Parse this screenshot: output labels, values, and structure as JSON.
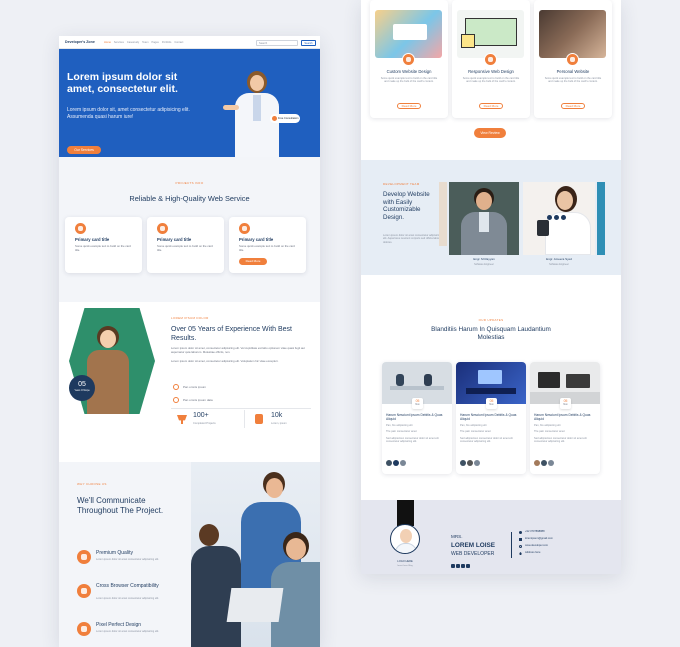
{
  "left_page": {
    "nav": {
      "logo": "Developer's Zone",
      "links": [
        "Home",
        "Services",
        "Casestudy",
        "Team",
        "Pages",
        "Portfolio",
        "Contact"
      ],
      "search_placeholder": "Search",
      "search_button": "Search"
    },
    "hero": {
      "title": "Lorem ipsum dolor sit amet, consectetur elit.",
      "subtitle": "Lorem ipsum dolor sit, amet consectetur adipisicing elit. Assumenda quasi harum iure!",
      "button": "Our Services",
      "badge": "Free Consultation"
    },
    "services": {
      "tag": "PROJECTS INFO",
      "title": "Reliable & High-Quality Web Service",
      "cards": [
        {
          "title": "Primary card title",
          "text": "Some quick example text to build on the card title.",
          "button": ""
        },
        {
          "title": "Primary card title",
          "text": "Some quick example text to build on the card title.",
          "button": ""
        },
        {
          "title": "Primary card title",
          "text": "Some quick example text to build on the card title.",
          "button": "Read More"
        }
      ]
    },
    "experience": {
      "tag": "LOREM IPSUM DOLOR",
      "title": "Over 05 Years of Experience With Best Results.",
      "paragraph": "Lorem ipsum dolor sit amet, consectetur adipisicing elit. Vel cupiditate est labo optionem vitae quasi fugit aut aspernatur quia laborum. Molestiae officiis, non.",
      "paragraph2": "Lorem ipsum dolor sit amet, consectetur adipisicing elit. Voluptatum hic vitae excepturi.",
      "badge_number": "05",
      "badge_label": "Years Of Expe",
      "items": [
        "Pan omnis ipsum",
        "Pan omnis ipsum data"
      ],
      "stats": [
        {
          "value": "100+",
          "label": "Completed Projects"
        },
        {
          "value": "10k",
          "label": "Lorem, ipsum"
        }
      ]
    },
    "why": {
      "tag": "WHY CHOOSE US",
      "title": "We'll Communicate Throughout The Project.",
      "features": [
        {
          "title": "Premium Quality",
          "text": "Lorem ipsum dolor sit amet consectetur adipisicing elit."
        },
        {
          "title": "Cross Browser Compatibility",
          "text": "Lorem ipsum dolor sit amet consectetur adipisicing elit."
        },
        {
          "title": "Pixel Perfect Design",
          "text": "Lorem ipsum dolor sit amet consectetur adipisicing elit."
        }
      ]
    }
  },
  "right_page": {
    "top_cards": [
      {
        "title": "Custom Website Design",
        "text": "Some quick example text to build on the card title and make up the bulk of the card's content.",
        "button": "Read More"
      },
      {
        "title": "Responsive Web Design",
        "text": "Some quick example text to build on the card title and make up the bulk of the card's content.",
        "button": "Read More"
      },
      {
        "title": "Personal Website",
        "text": "Some quick example text to build on the card title and make up the bulk of the card's content.",
        "button": "Read More"
      }
    ],
    "more_button": "View Review",
    "team": {
      "tag": "DEVELOPMENT TEAM",
      "title": "Develop Website with Easily Customizable Design.",
      "text": "Lorem ipsum dolor sit amet consectetur adipisicing elit. Asperiores nesciunt corporis sed officia laborum dolores.",
      "members": [
        {
          "name": "Engr. M.Rayyan",
          "role": "Software Engineer"
        },
        {
          "name": "Engr. Ameera Syed",
          "role": "Software Engineer"
        }
      ]
    },
    "blog": {
      "tag": "OUR UPDATES",
      "title": "Blanditiis Harum In Quisquam Laudantium Molestias",
      "posts": [
        {
          "day": "05",
          "month": "Nov",
          "title": "Harum Nesciunt Ipsum Debitis & Quas Aliquid",
          "meta1": "Pan, fire adipisicing elit",
          "meta2": "The pain consectetur amet",
          "text": "Sed adipiscicen consectetur dolor sit amet elit consectetur adipisicing elit."
        },
        {
          "day": "05",
          "month": "Nov",
          "title": "Harum Nesciunt Ipsum Debitis & Quas Aliquid",
          "meta1": "Pan, fire adipisicing elit",
          "meta2": "The pain consectetur amet",
          "text": "Sed adipiscicen consectetur dolor sit amet elit consectetur adipisicing elit."
        },
        {
          "day": "05",
          "month": "Nov",
          "title": "Harum Nesciunt Ipsum Debitis & Quas Aliquid",
          "meta1": "Pan, fire adipisicing elit",
          "meta2": "The pain consectetur amet",
          "text": "Sed adipiscicen consectetur dolor sit amet elit consectetur adipisicing elit."
        }
      ]
    },
    "footer": {
      "prefix": "MRS.",
      "name": "LOREM LOISE",
      "role": "WEB DEVELOPER",
      "logo": "LOGO HERE",
      "logo_sub": "Insert here Blog",
      "contacts": [
        "+92 3707898888",
        "loremipsum@gmail.com",
        "www.developer.com",
        "Address here"
      ]
    }
  },
  "colors": {
    "accent": "#f07f3c",
    "hero_blue": "#1f5fbf",
    "teal": "#2e8f6b",
    "navy": "#1e3a5f"
  }
}
